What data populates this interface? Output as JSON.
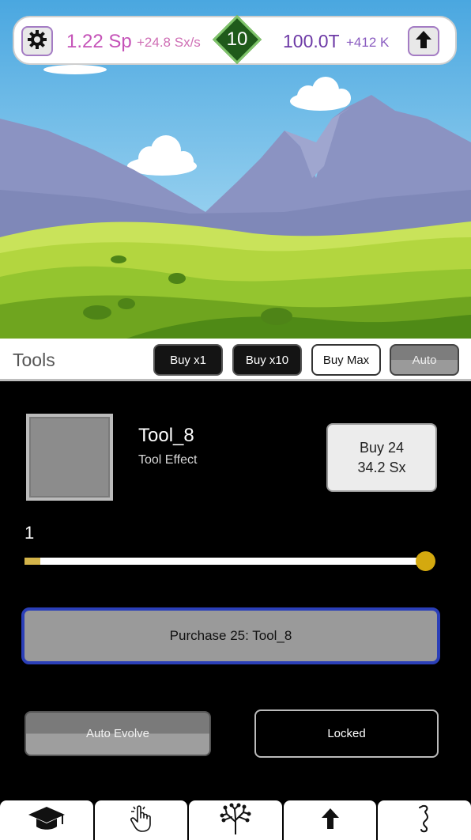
{
  "topbar": {
    "currency_primary": "1.22 Sp",
    "currency_primary_rate": "+24.8 Sx/s",
    "level": "10",
    "currency_secondary": "100.0T",
    "currency_secondary_rate": "+412 K",
    "settings_icon": "gear-icon",
    "upgrade_icon": "arrow-up-icon"
  },
  "tools": {
    "title": "Tools",
    "buy_modes": [
      "Buy x1",
      "Buy x10",
      "Buy Max",
      "Auto"
    ]
  },
  "tool_item": {
    "name": "Tool_8",
    "effect": "Tool Effect",
    "buy_line1": "Buy 24",
    "buy_line2": "34.2 Sx"
  },
  "slider": {
    "value": "1",
    "fill_fraction": 0.04
  },
  "purchase": {
    "label": "Purchase 25: Tool_8"
  },
  "actions": {
    "auto_evolve": "Auto Evolve",
    "locked": "Locked"
  },
  "bottom_nav": [
    {
      "icon": "graduation-cap-icon"
    },
    {
      "icon": "tap-hand-icon"
    },
    {
      "icon": "tree-icon"
    },
    {
      "icon": "arrow-up-icon"
    },
    {
      "icon": "seahorse-icon"
    }
  ],
  "colors": {
    "primary_currency": "#c553b8",
    "secondary_currency": "#6d3aa6",
    "level_badge": "#1f5a1a",
    "purchase_border": "#2b3fb8",
    "slider_thumb": "#d4a90f"
  }
}
